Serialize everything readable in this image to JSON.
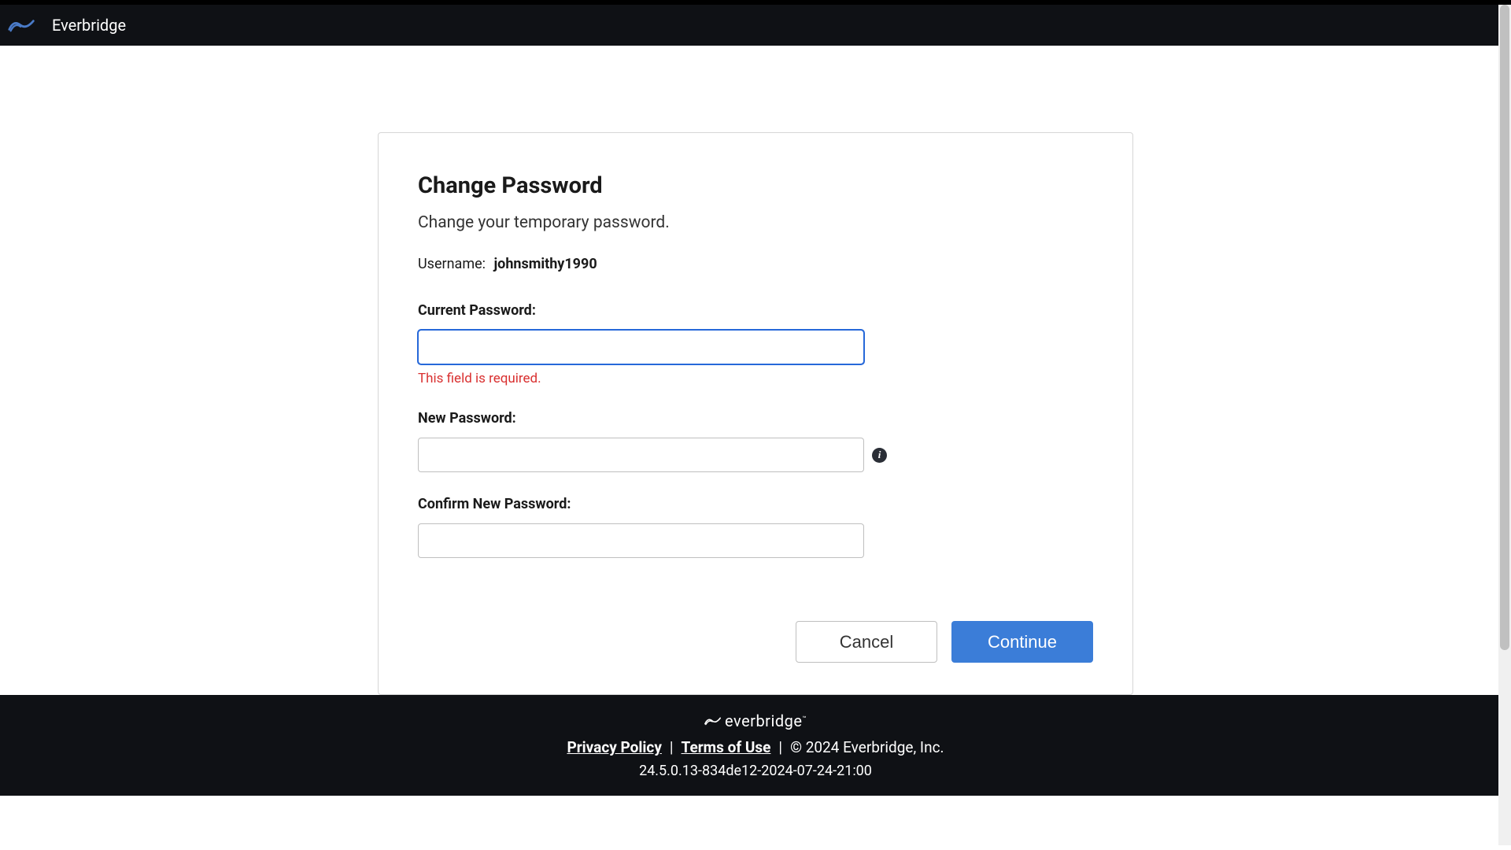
{
  "header": {
    "brand": "Everbridge"
  },
  "card": {
    "title": "Change Password",
    "subtitle": "Change your temporary password.",
    "username_label": "Username:",
    "username_value": "johnsmithy1990",
    "fields": {
      "current_password": {
        "label": "Current Password:",
        "value": "",
        "error": "This field is required."
      },
      "new_password": {
        "label": "New Password:",
        "value": ""
      },
      "confirm_password": {
        "label": "Confirm New Password:",
        "value": ""
      }
    },
    "buttons": {
      "cancel": "Cancel",
      "continue": "Continue"
    }
  },
  "footer": {
    "logo_text": "everbridge",
    "privacy_policy": "Privacy Policy",
    "terms_of_use": "Terms of Use",
    "copyright": "©  2024 Everbridge, Inc.",
    "version": "24.5.0.13-834de12-2024-07-24-21:00",
    "separator": "|"
  }
}
